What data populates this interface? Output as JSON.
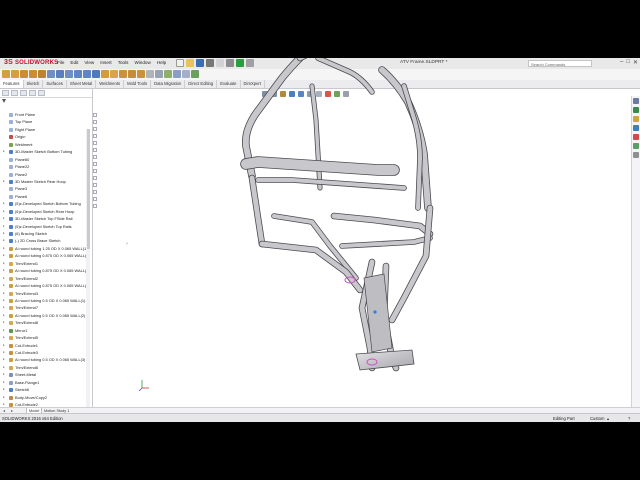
{
  "app": {
    "name": "SOLIDWORKS",
    "document_title": "ATV Frame.SLDPRT *"
  },
  "menu": [
    "File",
    "Edit",
    "View",
    "Insert",
    "Tools",
    "Window",
    "Help"
  ],
  "search_placeholder": "Search Commands",
  "window_controls": [
    "–",
    "□",
    "✕"
  ],
  "tabs": [
    "Features",
    "Sketch",
    "Surfaces",
    "Sheet Metal",
    "Weldments",
    "Mold Tools",
    "Data Migration",
    "Direct Editing",
    "Evaluate",
    "DimXpert"
  ],
  "tree": [
    {
      "label": "Front Plane",
      "icon": "plane-icon"
    },
    {
      "label": "Top Plane",
      "icon": "plane-icon"
    },
    {
      "label": "Right Plane",
      "icon": "plane-icon"
    },
    {
      "label": "Origin",
      "icon": "origin-icon"
    },
    {
      "label": "Weldment",
      "icon": "weldment-icon"
    },
    {
      "label": "3D-Master Sketch Bottom Tubing",
      "icon": "sketch-icon"
    },
    {
      "label": "Plane60",
      "icon": "plane-icon"
    },
    {
      "label": "Plane22",
      "icon": "plane-icon"
    },
    {
      "label": "Plane2",
      "icon": "plane-icon"
    },
    {
      "label": "3D Master Sketch Rear Hoop",
      "icon": "sketch-icon"
    },
    {
      "label": "Plane3",
      "icon": "plane-icon"
    },
    {
      "label": "Plane6",
      "icon": "plane-icon"
    },
    {
      "label": "(5)z-Developed Sketch Bottom Tubing",
      "icon": "sketch-icon"
    },
    {
      "label": "(6)z-Developed Sketch Rear Hoop",
      "icon": "sketch-icon"
    },
    {
      "label": "3D-Master Sketch Top FSide Rail",
      "icon": "sketch-icon"
    },
    {
      "label": "(5)z-Developed Sketch Top Rails",
      "icon": "sketch-icon"
    },
    {
      "label": "(6) Bracing Sketch",
      "icon": "sketch-icon"
    },
    {
      "label": "(-) 2D Cross Brace Sketch",
      "icon": "sketch-icon"
    },
    {
      "label": "Al round tubing 1.25 OD X 0.065 WALL(1)",
      "icon": "structure-icon"
    },
    {
      "label": "Al round tubing 0.875 OD X 0.065 WALL(1)",
      "icon": "structure-icon"
    },
    {
      "label": "Trim/Extend1",
      "icon": "trim-icon"
    },
    {
      "label": "Al round tubing 0.875 OD X 0.065 WALL(1)",
      "icon": "structure-icon"
    },
    {
      "label": "Trim/Extend2",
      "icon": "trim-icon"
    },
    {
      "label": "Al round tubing 0.875 OD X 0.065 WALL(2)",
      "icon": "structure-icon"
    },
    {
      "label": "Trim/Extend3",
      "icon": "trim-icon"
    },
    {
      "label": "Al round tubing 0.5 OD X 0.065 WALL(1)",
      "icon": "structure-icon"
    },
    {
      "label": "Trim/Extend7",
      "icon": "trim-icon"
    },
    {
      "label": "Al round tubing 0.5 OD X 0.065 WALL(2)",
      "icon": "structure-icon"
    },
    {
      "label": "Trim/Extend8",
      "icon": "trim-icon"
    },
    {
      "label": "Mirror1",
      "icon": "mirror-icon"
    },
    {
      "label": "Trim/Extend5",
      "icon": "trim-icon"
    },
    {
      "label": "Cut-Extrude1",
      "icon": "cut-icon"
    },
    {
      "label": "Cut-Extrude3",
      "icon": "cut-icon"
    },
    {
      "label": "Al round tubing 0.5 OD X 0.065 WALL(3)",
      "icon": "structure-icon"
    },
    {
      "label": "Trim/Extend6",
      "icon": "trim-icon"
    },
    {
      "label": "Sheet-Metal",
      "icon": "sheetmetal-icon"
    },
    {
      "label": "Base-Flange1",
      "icon": "flange-icon"
    },
    {
      "label": "Sketch6",
      "icon": "sketch-icon"
    },
    {
      "label": "Body-Move/Copy2",
      "icon": "move-icon"
    },
    {
      "label": "Cut-Extrude2",
      "icon": "cut-icon"
    },
    {
      "label": "Flat-Pattern",
      "icon": "flatpattern-icon"
    }
  ],
  "bottom_tabs": [
    "Model",
    "Motion Study 1"
  ],
  "status": {
    "left": "SOLIDWORKS 2016 x64 Edition",
    "mode": "Editing Part",
    "units": "Custom"
  },
  "colors": {
    "accent_red": "#c8102e",
    "tube_metal": "#c8c8cc",
    "tube_edge": "#4a4a4f",
    "selection_magenta": "#c94fc8"
  }
}
